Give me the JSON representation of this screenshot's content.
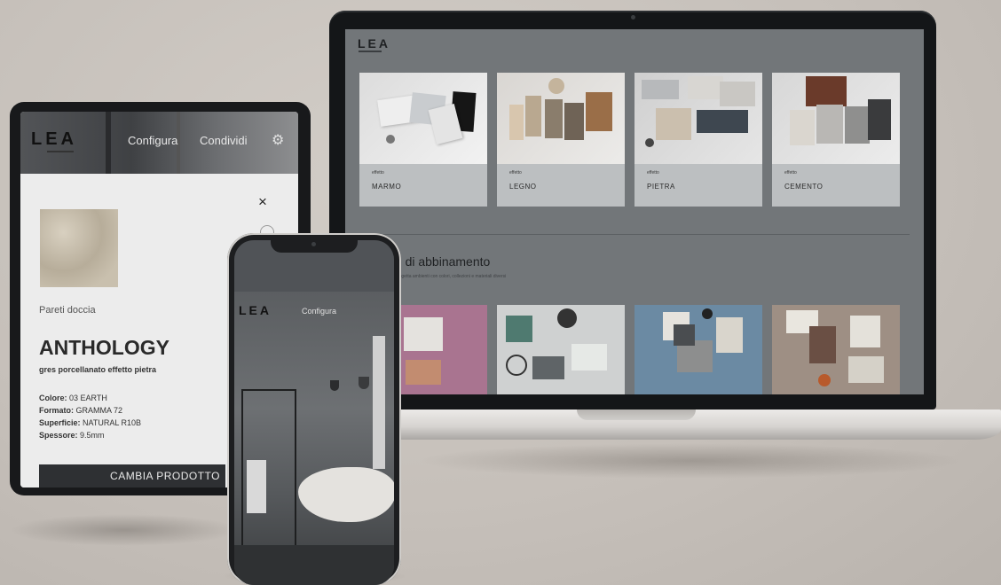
{
  "laptop": {
    "logo": "LEA",
    "tiles": [
      {
        "small": "effetto",
        "name": "MARMO"
      },
      {
        "small": "effetto",
        "name": "LEGNO"
      },
      {
        "small": "effetto",
        "name": "PIETRA"
      },
      {
        "small": "effetto",
        "name": "CEMENTO"
      }
    ],
    "section_title": "te di abbinamento",
    "section_sub": "...progetta ambienti con colori, collezioni e materiali diversi"
  },
  "tablet": {
    "logo": "LEA",
    "nav": [
      "Configura",
      "Condividi"
    ],
    "close": "×",
    "category": "Pareti doccia",
    "product": "ANTHOLOGY",
    "description": "gres porcellanato effetto pietra",
    "specs": [
      {
        "label": "Colore:",
        "value": "03 EARTH"
      },
      {
        "label": "Formato:",
        "value": "GRAMMA 72"
      },
      {
        "label": "Superficie:",
        "value": "NATURAL R10B"
      },
      {
        "label": "Spessore:",
        "value": "9.5mm"
      }
    ],
    "button": "CAMBIA PRODOTTO"
  },
  "phone": {
    "logo": "LEA",
    "nav": "Configura"
  },
  "colors": {
    "background": "#c8c2bc",
    "laptop_screen": "#727679",
    "tile_label": "#bcbfc1",
    "dark_button": "#2e3033"
  }
}
